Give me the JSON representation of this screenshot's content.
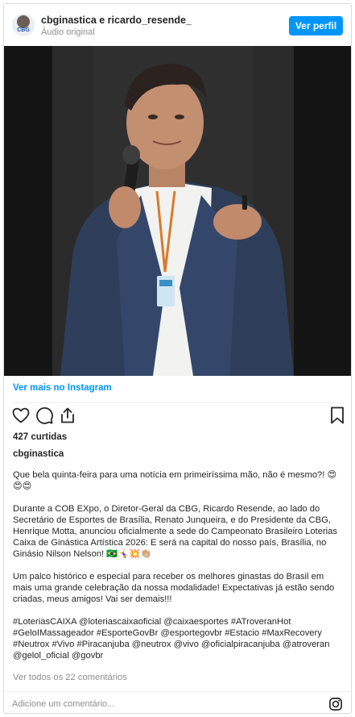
{
  "header": {
    "username": "cbginastica e ricardo_resende_",
    "subtitle": "Áudio original",
    "avatar_text": "CBG",
    "follow_label": "Ver perfil"
  },
  "post": {
    "view_more_label": "Ver mais no Instagram",
    "likes": "427 curtidas",
    "owner": "cbginastica",
    "caption": [
      "Que bela quinta-feira para uma notícia em primeiríssima mão, não é mesmo?! 😍😍😍",
      "Durante a COB EXpo, o Diretor-Geral da CBG, Ricardo Resende, ao lado do Secretário de Esportes de Brasília, Renato Junqueira, e do Presidente da CBG, Henrique Motta, anunciou oficialmente a sede do Campeonato Brasileiro Loterias Caixa de Ginástica Artística 2026: E será na capital do nosso país, Brasília, no Ginásio Nilson Nelson! 🇧🇷🤸‍♀️💥👏🏼",
      "Um palco histórico e especial para receber os melhores ginastas do Brasil em mais uma grande celebração da nossa modalidade! Expectativas já estão sendo criadas, meus amigos! Vai ser demais!!!",
      "#LoteriasCAIXA @loteriascaixaoficial @caixaesportes #ATroveranHot #GeloIMassageador #EsporteGovBr @esportegovbr #Estacio #MaxRecovery #Neutrox #Vivo #Piracanjuba @neutrox @vivo @oficialpiracanjuba @atroveran @gelol_oficial @govbr"
    ],
    "comments_link": "Ver todos os 22 comentários",
    "comment_placeholder": "Adicione um comentário..."
  },
  "icons": {
    "like": "heart-icon",
    "comment": "comment-icon",
    "share": "share-icon",
    "save": "bookmark-icon",
    "brand": "instagram-icon"
  },
  "colors": {
    "accent": "#0095f6",
    "text": "#262626",
    "muted": "#8e8e8e",
    "border": "#dbdbdb"
  }
}
